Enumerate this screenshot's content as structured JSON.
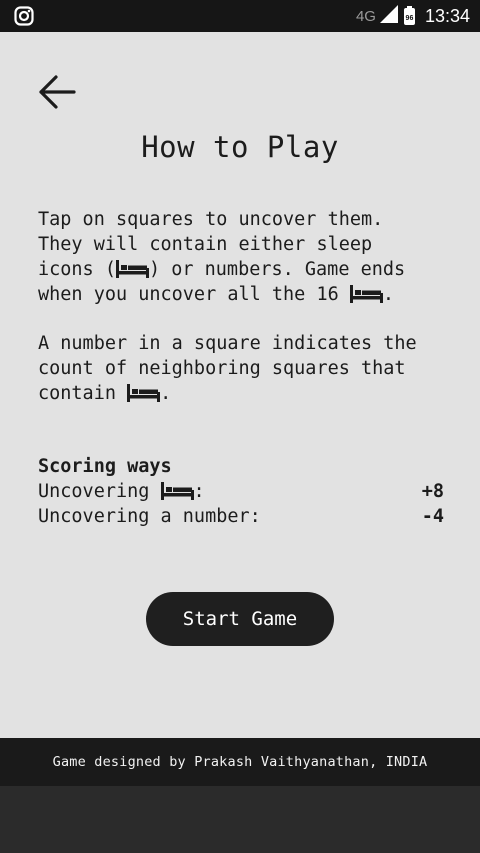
{
  "status_bar": {
    "network_label": "4G",
    "battery_level": "96",
    "time": "13:34",
    "notification_icon": "instagram-icon"
  },
  "page": {
    "title": "How to Play",
    "back_icon": "arrow-left-icon"
  },
  "instructions": {
    "p1_line1": "Tap on squares to uncover them.",
    "p1_line2": "They will contain either sleep",
    "p1_line3a": "icons (",
    "p1_line3b": ") or numbers. Game ends",
    "p1_line4a": "when you uncover all the 16 ",
    "p1_line4b": ".",
    "p2_line1": "A number in a square indicates the",
    "p2_line2": "count of neighboring squares that",
    "p2_line3a": "contain ",
    "p2_line3b": "."
  },
  "scoring": {
    "title": "Scoring ways",
    "rows": [
      {
        "label_a": "Uncovering ",
        "label_b": ":",
        "value": "+8",
        "icon": "bed-icon"
      },
      {
        "label_a": "Uncovering a number:",
        "value": "-4"
      }
    ]
  },
  "actions": {
    "start_label": "Start Game"
  },
  "footer": {
    "credit": "Game designed by Prakash Vaithyanathan, INDIA"
  },
  "colors": {
    "background": "#e2e2e2",
    "text": "#1c1c1c",
    "button": "#1f1f1f",
    "footer": "#1a1a1a",
    "status_bar": "#161616"
  }
}
